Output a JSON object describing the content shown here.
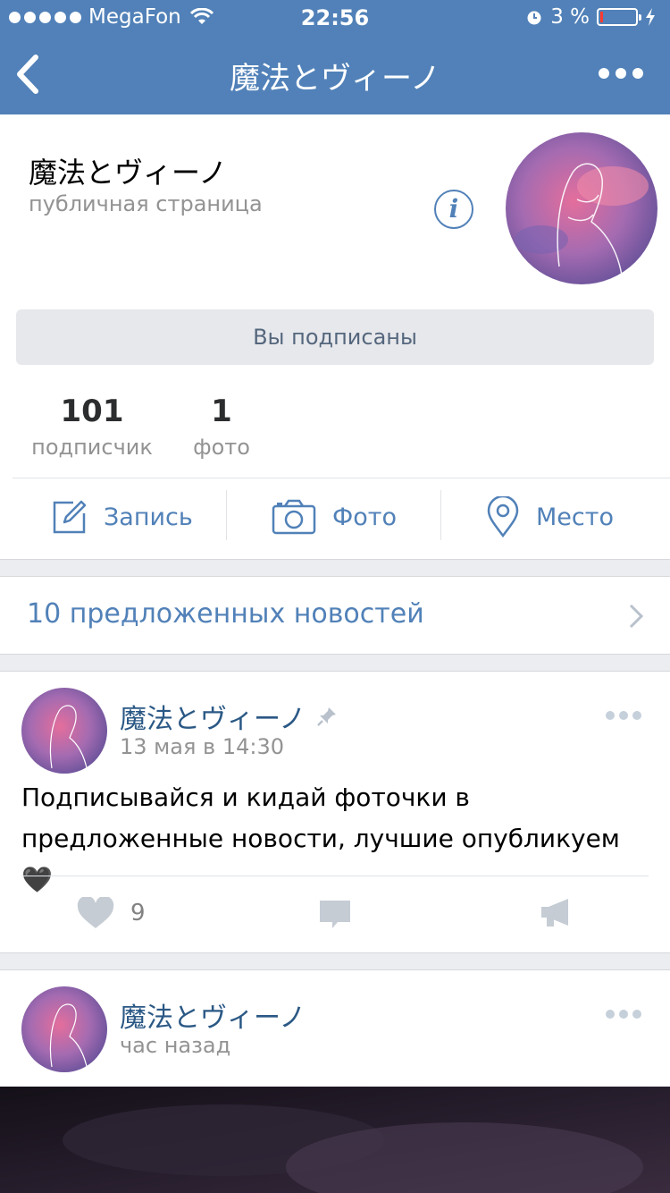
{
  "status_bar": {
    "carrier": "MegaFon",
    "time": "22:56",
    "battery": "3 %"
  },
  "nav": {
    "title": "魔法とヴィーノ"
  },
  "profile": {
    "name": "魔法とヴィーノ",
    "type": "публичная страница",
    "subscribe_label": "Вы подписаны",
    "stats": [
      {
        "value": "101",
        "label": "подписчик"
      },
      {
        "value": "1",
        "label": "фото"
      }
    ],
    "actions": [
      {
        "label": "Запись",
        "icon": "compose-icon"
      },
      {
        "label": "Фото",
        "icon": "camera-icon"
      },
      {
        "label": "Место",
        "icon": "location-pin-icon"
      }
    ]
  },
  "suggested": {
    "label": "10 предложенных новостей"
  },
  "posts": [
    {
      "author": "魔法とヴィーノ",
      "time": "13 мая в 14:30",
      "text": "Подписывайся и кидай фоточки в предложенные новости, лучшие опубликуем🖤",
      "likes": "9"
    },
    {
      "author": "魔法とヴィーノ",
      "time": "час назад"
    }
  ],
  "colors": {
    "header": "#5181b8",
    "link": "#5181b8",
    "author": "#2a5885",
    "muted": "#939393"
  }
}
